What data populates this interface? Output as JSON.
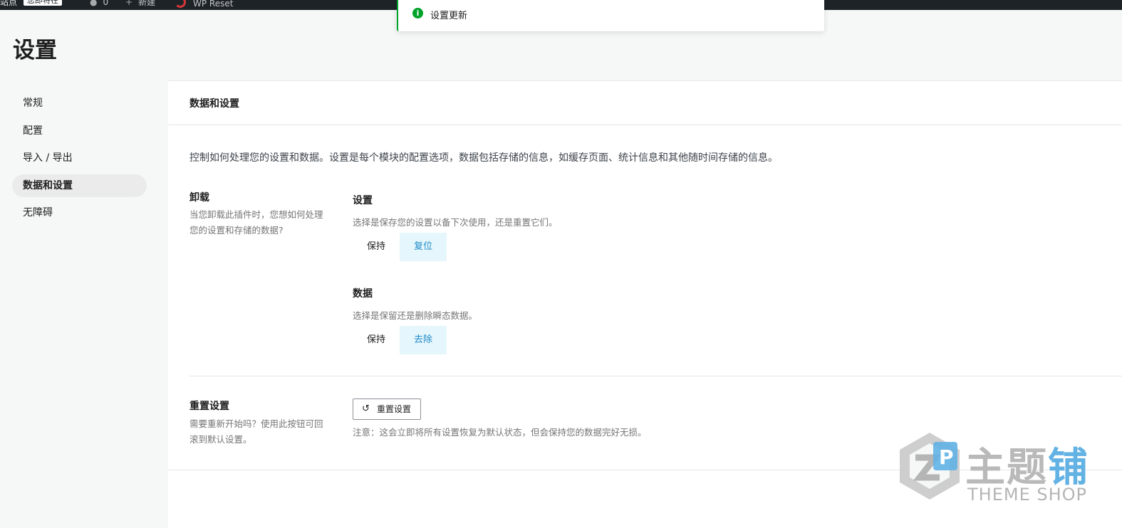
{
  "admin_bar": {
    "site": "站点",
    "status_chip": "您即将在",
    "comments_count": "0",
    "new_label": "新建",
    "wp_reset_label": "WP Reset"
  },
  "toast": {
    "icon": "info-icon",
    "message": "设置更新"
  },
  "page": {
    "title": "设置"
  },
  "nav": {
    "items": [
      {
        "label": "常规",
        "active": false
      },
      {
        "label": "配置",
        "active": false
      },
      {
        "label": "导入 / 导出",
        "active": false
      },
      {
        "label": "数据和设置",
        "active": true
      },
      {
        "label": "无障碍",
        "active": false
      }
    ]
  },
  "panel": {
    "title": "数据和设置",
    "description": "控制如何处理您的设置和数据。设置是每个模块的配置选项，数据包括存储的信息，如缓存页面、统计信息和其他随时间存储的信息。",
    "uninstall": {
      "title": "卸载",
      "description_line1": "当您卸载此插件时，您想如何处理",
      "description_line2": "您的设置和存储的数据?",
      "settings": {
        "title": "设置",
        "description": "选择是保存您的设置以备下次使用，还是重置它们。",
        "options": [
          "保持",
          "复位"
        ],
        "selected": "复位"
      },
      "data": {
        "title": "数据",
        "description": "选择是保留还是删除瞬态数据。",
        "options": [
          "保持",
          "去除"
        ],
        "selected": "去除"
      }
    },
    "reset": {
      "title": "重置设置",
      "description_line1": "需要重新开始吗？使用此按钮可回",
      "description_line2": "滚到默认设置。",
      "button_label": "重置设置",
      "note": "注意：这会立即将所有设置恢复为默认状态，但会保持您的数据完好无损。"
    }
  },
  "watermark": {
    "cn_part1": "主题",
    "cn_part2": "铺",
    "en": "THEME SHOP"
  },
  "colors": {
    "accent": "#1f8cc7",
    "selected_bg": "#e6f6fd",
    "success": "#00a32a",
    "admin_bar": "#1d2327"
  }
}
